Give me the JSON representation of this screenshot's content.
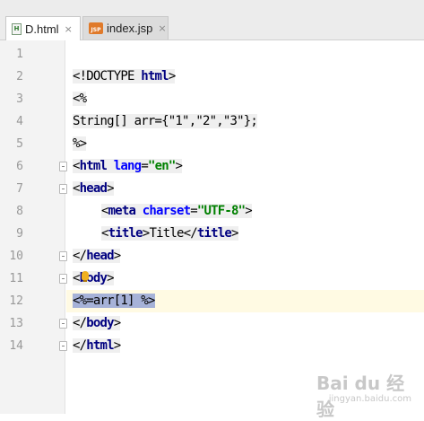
{
  "tabs": [
    {
      "label": "D.html",
      "icon": "html-file-icon",
      "active": true,
      "close": "×"
    },
    {
      "label": "index.jsp",
      "icon": "jsp-file-icon",
      "active": false,
      "close": "×"
    }
  ],
  "icons": {
    "html_badge": "H",
    "jsp_badge": "JSP"
  },
  "editor": {
    "line_numbers": [
      "1",
      "2",
      "3",
      "4",
      "5",
      "6",
      "7",
      "8",
      "9",
      "10",
      "11",
      "12",
      "13",
      "14"
    ],
    "current_line": "12",
    "lines": {
      "l2": {
        "p1": "<!DOCTYPE ",
        "p2": "html",
        "p3": ">"
      },
      "l3": "<%",
      "l4": "String[] arr={\"1\",\"2\",\"3\"};",
      "l5": "%>",
      "l6": {
        "p1": "<",
        "tag": "html",
        "p2": " ",
        "attr": "lang",
        "p3": "=",
        "val": "\"en\"",
        "p4": ">"
      },
      "l7": {
        "p1": "<",
        "tag": "head",
        "p2": ">"
      },
      "l8": {
        "p1": "<",
        "tag": "meta",
        "p2": " ",
        "attr": "charset",
        "p3": "=",
        "val": "\"UTF-8\"",
        "p4": ">"
      },
      "l9": {
        "p1": "<",
        "tag": "title",
        "p2": ">",
        "text": "Title",
        "p3": "</",
        "tag2": "title",
        "p4": ">"
      },
      "l10": {
        "p1": "</",
        "tag": "head",
        "p2": ">"
      },
      "l11": {
        "p1": "<",
        "tag": "body",
        "p2": ">"
      },
      "l12": "<%=arr[1] %>",
      "l13": {
        "p1": "</",
        "tag": "body",
        "p2": ">"
      },
      "l14": {
        "p1": "</",
        "tag": "html",
        "p2": ">"
      }
    }
  },
  "watermark": {
    "main": "Bai du 经验",
    "sub": "jingyan.baidu.com"
  }
}
